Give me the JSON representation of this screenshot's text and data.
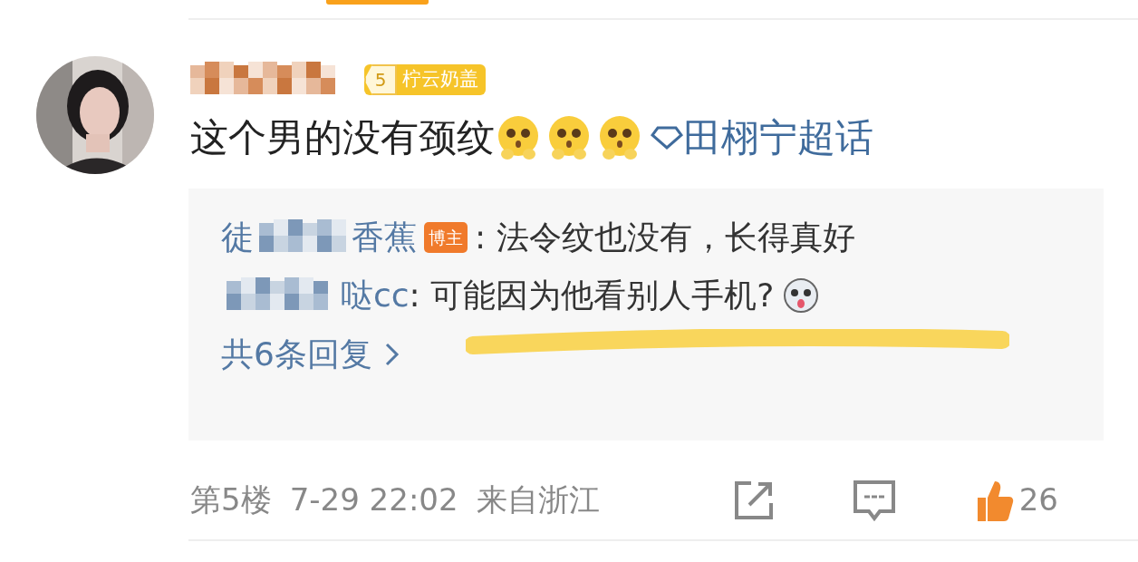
{
  "comment": {
    "author": {
      "level": "5",
      "badge": "柠云奶盖"
    },
    "text": "这个男的没有颈纹",
    "emojis": [
      {
        "kind": "pleading"
      },
      {
        "kind": "pleading"
      },
      {
        "kind": "pleading"
      }
    ],
    "topic": "田栩宁超话",
    "replies": [
      {
        "name_start": "徒",
        "name_end": "香蕉",
        "tag": "博主",
        "text": ": 法令纹也没有，长得真好"
      },
      {
        "name_end": "哒cc",
        "text": ": 可能因为他看别人手机?",
        "emoji": {
          "kind": "dog"
        }
      }
    ],
    "more_replies": "共6条回复",
    "floor": "第5楼",
    "time": "7-29 22:02",
    "location": "来自浙江",
    "likes": "26",
    "liked": true
  }
}
